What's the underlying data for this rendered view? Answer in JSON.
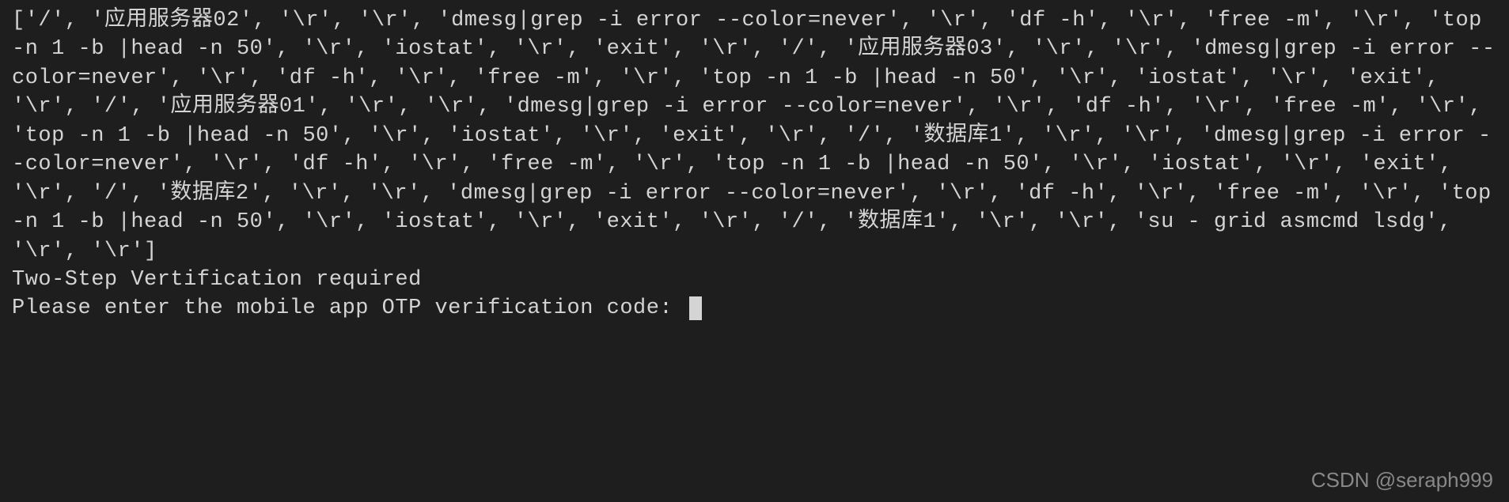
{
  "terminal": {
    "list_output": "['/', '应用服务器02', '\\r', '\\r', 'dmesg|grep -i error --color=never', '\\r', 'df -h', '\\r', 'free -m', '\\r', 'top -n 1 -b |head -n 50', '\\r', 'iostat', '\\r', 'exit', '\\r', '/', '应用服务器03', '\\r', '\\r', 'dmesg|grep -i error --color=never', '\\r', 'df -h', '\\r', 'free -m', '\\r', 'top -n 1 -b |head -n 50', '\\r', 'iostat', '\\r', 'exit', '\\r', '/', '应用服务器01', '\\r', '\\r', 'dmesg|grep -i error --color=never', '\\r', 'df -h', '\\r', 'free -m', '\\r', 'top -n 1 -b |head -n 50', '\\r', 'iostat', '\\r', 'exit', '\\r', '/', '数据库1', '\\r', '\\r', 'dmesg|grep -i error --color=never', '\\r', 'df -h', '\\r', 'free -m', '\\r', 'top -n 1 -b |head -n 50', '\\r', 'iostat', '\\r', 'exit', '\\r', '/', '数据库2', '\\r', '\\r', 'dmesg|grep -i error --color=never', '\\r', 'df -h', '\\r', 'free -m', '\\r', 'top -n 1 -b |head -n 50', '\\r', 'iostat', '\\r', 'exit', '\\r', '/', '数据库1', '\\r', '\\r', 'su - grid asmcmd lsdg', '\\r', '\\r']",
    "line_verification": "Two-Step Vertification required",
    "line_prompt": "Please enter the mobile app OTP verification code: "
  },
  "watermark": "CSDN @seraph999"
}
